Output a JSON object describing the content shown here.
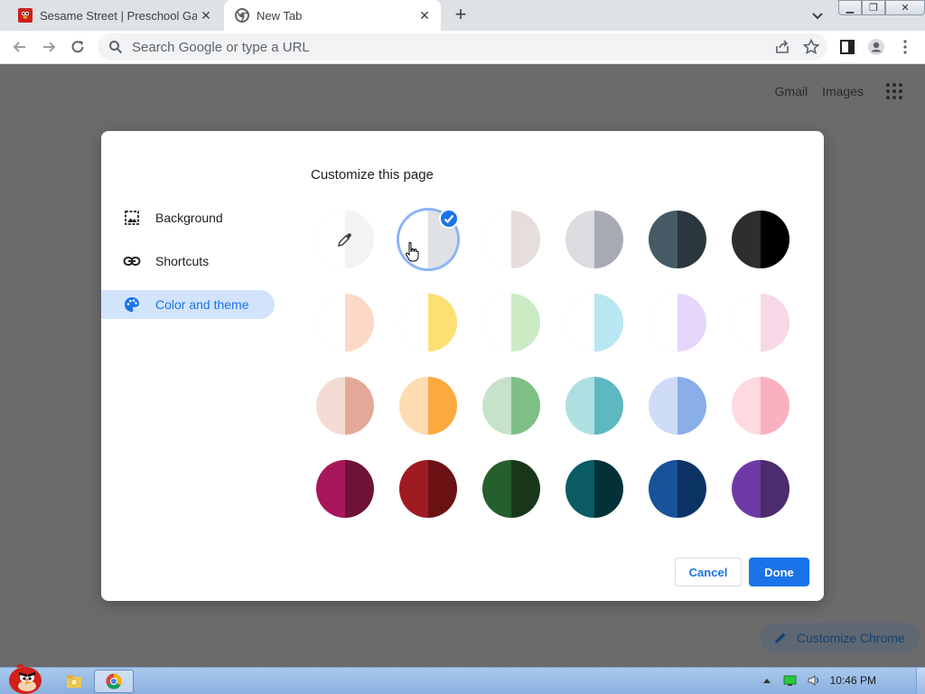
{
  "tabs": [
    {
      "title": "Sesame Street | Preschool Games",
      "active": false
    },
    {
      "title": "New Tab",
      "active": true
    }
  ],
  "toolbar": {
    "omnibox_placeholder": "Search Google or type a URL"
  },
  "page": {
    "links": [
      "Gmail",
      "Images"
    ],
    "customize_chrome": "Customize Chrome"
  },
  "dialog": {
    "title": "Customize this page",
    "nav": [
      {
        "label": "Background",
        "icon": "image-icon",
        "selected": false
      },
      {
        "label": "Shortcuts",
        "icon": "link-icon",
        "selected": false
      },
      {
        "label": "Color and theme",
        "icon": "palette-icon",
        "selected": true
      }
    ],
    "swatches": [
      [
        [
          "#f1f3f4",
          "#f1f3f4"
        ],
        [
          "#ffffff",
          "#dee1e6"
        ],
        [
          "#ffffff",
          "#e6deda"
        ],
        [
          "#dadce0",
          "#a7aab3"
        ],
        [
          "#455a64",
          "#2b373e"
        ],
        [
          "#2e2e2e",
          "#000000"
        ]
      ],
      [
        [
          "#ffffff",
          "#fcd9c6"
        ],
        [
          "#ffffff",
          "#fde073"
        ],
        [
          "#ffffff",
          "#ccebc4"
        ],
        [
          "#ffffff",
          "#b9e7f1"
        ],
        [
          "#ffffff",
          "#e6d5fb"
        ],
        [
          "#ffffff",
          "#f8d8e6"
        ]
      ],
      [
        [
          "#f2dcd4",
          "#e3a897"
        ],
        [
          "#fedcb2",
          "#fca940"
        ],
        [
          "#c6e3c9",
          "#7dbf84"
        ],
        [
          "#aee0e2",
          "#5db8c0"
        ],
        [
          "#cfdcf8",
          "#89aee9"
        ],
        [
          "#fdd9e0",
          "#fbb0bf"
        ]
      ],
      [
        [
          "#a8175a",
          "#6e1236"
        ],
        [
          "#a01a22",
          "#6b1214"
        ],
        [
          "#265f2e",
          "#19361b"
        ],
        [
          "#0a5b64",
          "#033137"
        ],
        [
          "#18529a",
          "#0b3363"
        ],
        [
          "#6e3aa5",
          "#4b2c6d"
        ]
      ]
    ],
    "selected_swatch": "white-grey",
    "cancel_label": "Cancel",
    "done_label": "Done"
  },
  "taskbar": {
    "clock": "10:46 PM"
  },
  "colors": {
    "accent": "#1a73e8",
    "page_overlay": "#6b6b6b"
  }
}
